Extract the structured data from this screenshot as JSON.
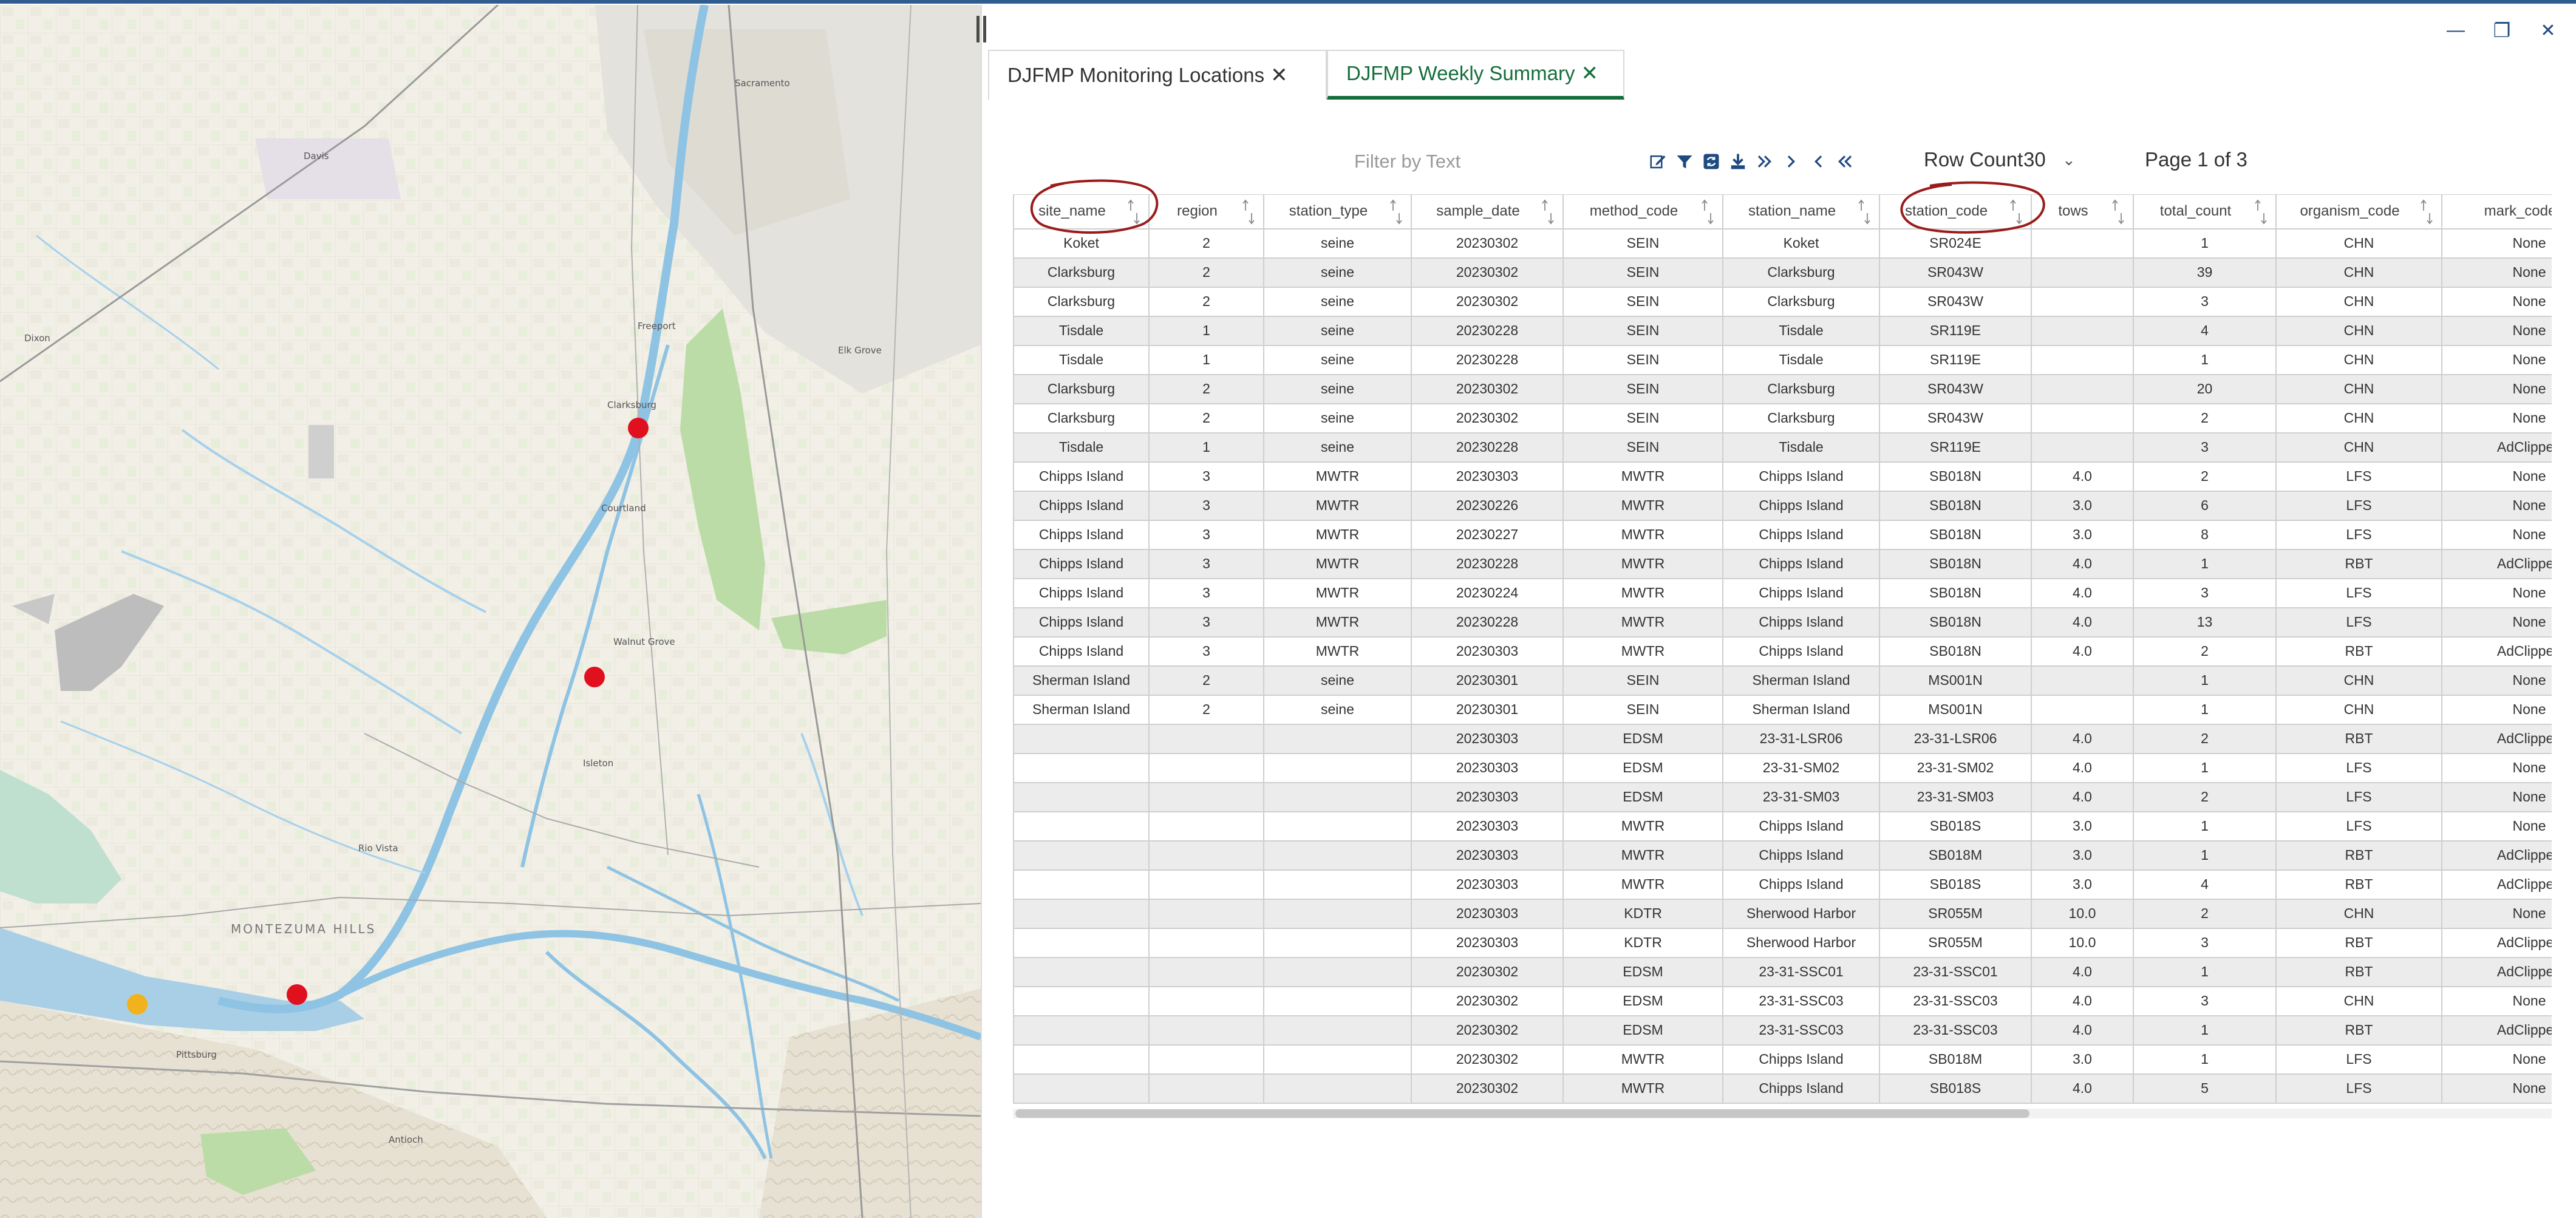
{
  "window": {
    "minimize_glyph": "—",
    "maximize_glyph": "❐",
    "close_glyph": "✕"
  },
  "tabs": [
    {
      "label": "DJFMP Monitoring Locations",
      "close": "✕",
      "active": false
    },
    {
      "label": "DJFMP Weekly Summary",
      "close": "✕",
      "active": true
    }
  ],
  "toolbar": {
    "filter_placeholder": "Filter by Text",
    "row_count_label": "Row Count",
    "row_count_value": "30",
    "page_indicator": "Page 1 of 3",
    "icons": [
      "edit-icon",
      "filter-icon",
      "refresh-icon",
      "download-icon",
      "last-page-icon",
      "next-page-icon",
      "previous-page-icon",
      "first-page-icon"
    ]
  },
  "colors": {
    "accent": "#146e3c",
    "annotation": "#9b1b1b",
    "map_point_red": "#e0101e",
    "map_point_yellow": "#f2b21e",
    "water": "#a9cfe6"
  },
  "map": {
    "labels": [
      "Sacramento",
      "Davis",
      "Elk Grove",
      "Dixon",
      "Rio Vista",
      "Antioch",
      "Pittsburg",
      "MONTEZUMA HILLS",
      "Isleton",
      "Walnut Grove",
      "Courtland",
      "Clarksburg",
      "Freeport"
    ]
  },
  "table": {
    "columns": [
      "site_name",
      "region",
      "station_type",
      "sample_date",
      "method_code",
      "station_name",
      "station_code",
      "tows",
      "total_count",
      "organism_code",
      "mark_code"
    ],
    "rows": [
      [
        "Koket",
        "2",
        "seine",
        "20230302",
        "SEIN",
        "Koket",
        "SR024E",
        "",
        "1",
        "CHN",
        "None"
      ],
      [
        "Clarksburg",
        "2",
        "seine",
        "20230302",
        "SEIN",
        "Clarksburg",
        "SR043W",
        "",
        "39",
        "CHN",
        "None"
      ],
      [
        "Clarksburg",
        "2",
        "seine",
        "20230302",
        "SEIN",
        "Clarksburg",
        "SR043W",
        "",
        "3",
        "CHN",
        "None"
      ],
      [
        "Tisdale",
        "1",
        "seine",
        "20230228",
        "SEIN",
        "Tisdale",
        "SR119E",
        "",
        "4",
        "CHN",
        "None"
      ],
      [
        "Tisdale",
        "1",
        "seine",
        "20230228",
        "SEIN",
        "Tisdale",
        "SR119E",
        "",
        "1",
        "CHN",
        "None"
      ],
      [
        "Clarksburg",
        "2",
        "seine",
        "20230302",
        "SEIN",
        "Clarksburg",
        "SR043W",
        "",
        "20",
        "CHN",
        "None"
      ],
      [
        "Clarksburg",
        "2",
        "seine",
        "20230302",
        "SEIN",
        "Clarksburg",
        "SR043W",
        "",
        "2",
        "CHN",
        "None"
      ],
      [
        "Tisdale",
        "1",
        "seine",
        "20230228",
        "SEIN",
        "Tisdale",
        "SR119E",
        "",
        "3",
        "CHN",
        "AdClipped"
      ],
      [
        "Chipps Island",
        "3",
        "MWTR",
        "20230303",
        "MWTR",
        "Chipps Island",
        "SB018N",
        "4.0",
        "2",
        "LFS",
        "None"
      ],
      [
        "Chipps Island",
        "3",
        "MWTR",
        "20230226",
        "MWTR",
        "Chipps Island",
        "SB018N",
        "3.0",
        "6",
        "LFS",
        "None"
      ],
      [
        "Chipps Island",
        "3",
        "MWTR",
        "20230227",
        "MWTR",
        "Chipps Island",
        "SB018N",
        "3.0",
        "8",
        "LFS",
        "None"
      ],
      [
        "Chipps Island",
        "3",
        "MWTR",
        "20230228",
        "MWTR",
        "Chipps Island",
        "SB018N",
        "4.0",
        "1",
        "RBT",
        "AdClipped"
      ],
      [
        "Chipps Island",
        "3",
        "MWTR",
        "20230224",
        "MWTR",
        "Chipps Island",
        "SB018N",
        "4.0",
        "3",
        "LFS",
        "None"
      ],
      [
        "Chipps Island",
        "3",
        "MWTR",
        "20230228",
        "MWTR",
        "Chipps Island",
        "SB018N",
        "4.0",
        "13",
        "LFS",
        "None"
      ],
      [
        "Chipps Island",
        "3",
        "MWTR",
        "20230303",
        "MWTR",
        "Chipps Island",
        "SB018N",
        "4.0",
        "2",
        "RBT",
        "AdClipped"
      ],
      [
        "Sherman Island",
        "2",
        "seine",
        "20230301",
        "SEIN",
        "Sherman Island",
        "MS001N",
        "",
        "1",
        "CHN",
        "None"
      ],
      [
        "Sherman Island",
        "2",
        "seine",
        "20230301",
        "SEIN",
        "Sherman Island",
        "MS001N",
        "",
        "1",
        "CHN",
        "None"
      ],
      [
        "",
        "",
        "",
        "20230303",
        "EDSM",
        "23-31-LSR06",
        "23-31-LSR06",
        "4.0",
        "2",
        "RBT",
        "AdClipped"
      ],
      [
        "",
        "",
        "",
        "20230303",
        "EDSM",
        "23-31-SM02",
        "23-31-SM02",
        "4.0",
        "1",
        "LFS",
        "None"
      ],
      [
        "",
        "",
        "",
        "20230303",
        "EDSM",
        "23-31-SM03",
        "23-31-SM03",
        "4.0",
        "2",
        "LFS",
        "None"
      ],
      [
        "",
        "",
        "",
        "20230303",
        "MWTR",
        "Chipps Island",
        "SB018S",
        "3.0",
        "1",
        "LFS",
        "None"
      ],
      [
        "",
        "",
        "",
        "20230303",
        "MWTR",
        "Chipps Island",
        "SB018M",
        "3.0",
        "1",
        "RBT",
        "AdClipped"
      ],
      [
        "",
        "",
        "",
        "20230303",
        "MWTR",
        "Chipps Island",
        "SB018S",
        "3.0",
        "4",
        "RBT",
        "AdClipped"
      ],
      [
        "",
        "",
        "",
        "20230303",
        "KDTR",
        "Sherwood Harbor",
        "SR055M",
        "10.0",
        "2",
        "CHN",
        "None"
      ],
      [
        "",
        "",
        "",
        "20230303",
        "KDTR",
        "Sherwood Harbor",
        "SR055M",
        "10.0",
        "3",
        "RBT",
        "AdClipped"
      ],
      [
        "",
        "",
        "",
        "20230302",
        "EDSM",
        "23-31-SSC01",
        "23-31-SSC01",
        "4.0",
        "1",
        "RBT",
        "AdClipped"
      ],
      [
        "",
        "",
        "",
        "20230302",
        "EDSM",
        "23-31-SSC03",
        "23-31-SSC03",
        "4.0",
        "3",
        "CHN",
        "None"
      ],
      [
        "",
        "",
        "",
        "20230302",
        "EDSM",
        "23-31-SSC03",
        "23-31-SSC03",
        "4.0",
        "1",
        "RBT",
        "AdClipped"
      ],
      [
        "",
        "",
        "",
        "20230302",
        "MWTR",
        "Chipps Island",
        "SB018M",
        "3.0",
        "1",
        "LFS",
        "None"
      ],
      [
        "",
        "",
        "",
        "20230302",
        "MWTR",
        "Chipps Island",
        "SB018S",
        "4.0",
        "5",
        "LFS",
        "None"
      ]
    ]
  }
}
